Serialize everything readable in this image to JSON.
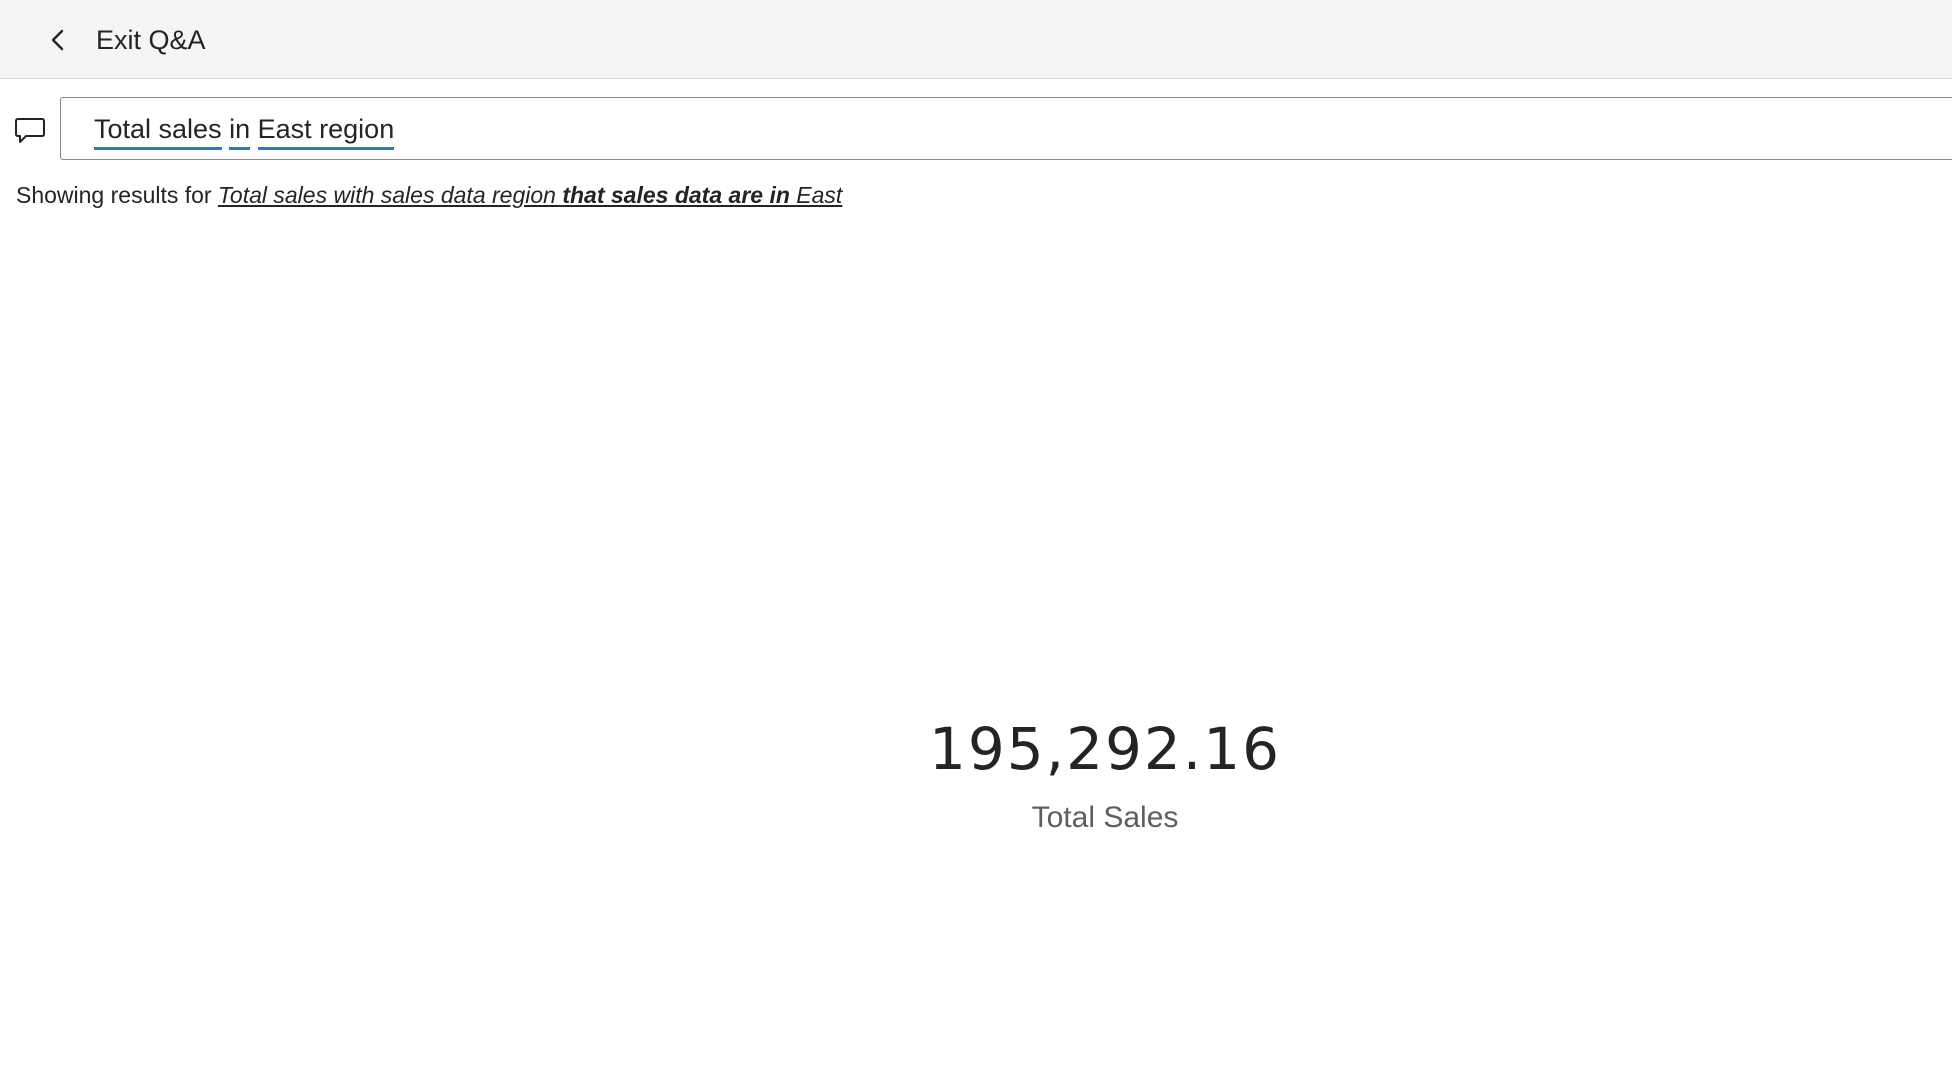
{
  "header": {
    "exit_label": "Exit Q&A",
    "back_icon": "chevron-left-icon"
  },
  "query": {
    "icon": "chat-bubble-icon",
    "words": [
      "Total sales",
      "in",
      "East region"
    ],
    "separator": " ",
    "underline_color": "#3b74c4"
  },
  "results": {
    "prefix": "Showing results for ",
    "restatement": {
      "part1": "Total sales with sales data region ",
      "part2_bold": "that sales data are in",
      "part3": " East"
    }
  },
  "card": {
    "value": "195,292.16",
    "label": "Total Sales"
  }
}
